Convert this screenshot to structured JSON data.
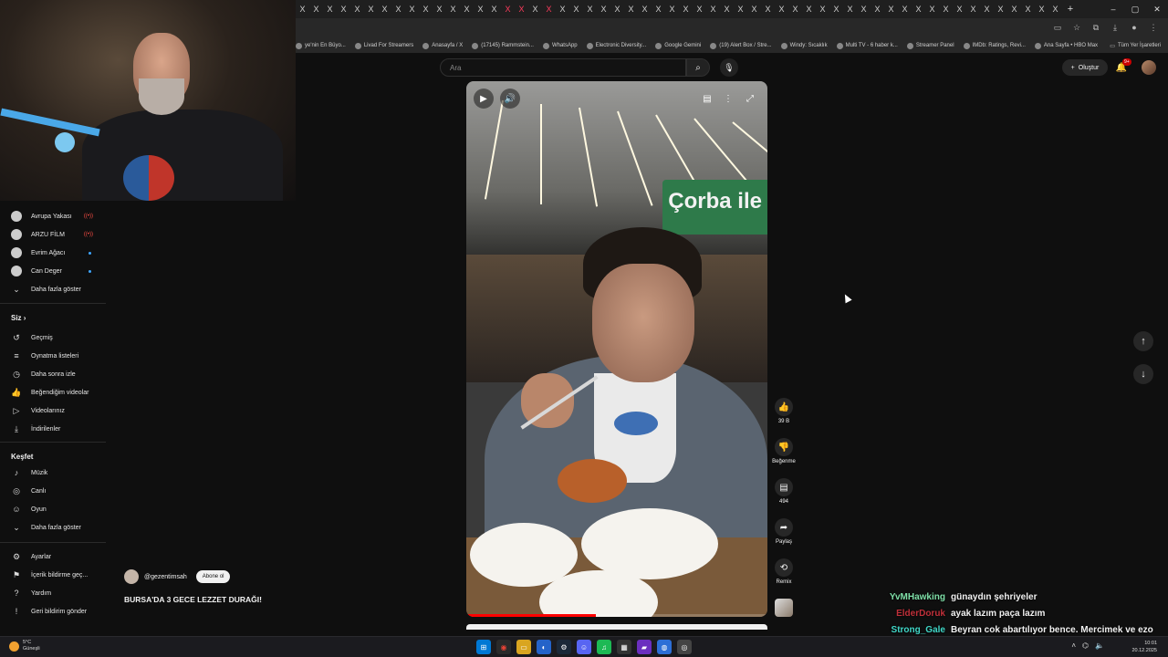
{
  "browser": {
    "tab_count": 56,
    "tab_close_glyph": "X",
    "new_tab_glyph": "+",
    "window_controls": [
      "–",
      "▢",
      "✕"
    ],
    "bookmarks": [
      {
        "label": "ye'nin En Büyo...",
        "icon": "bookmark-icon"
      },
      {
        "label": "Livad For Streamers",
        "icon": "livad-icon"
      },
      {
        "label": "Anasayfa / X",
        "icon": "x-logo-icon"
      },
      {
        "label": "(17145) Rammstein...",
        "icon": "youtube-icon"
      },
      {
        "label": "WhatsApp",
        "icon": "whatsapp-icon"
      },
      {
        "label": "Electronic Diversity...",
        "icon": "bookmark-icon"
      },
      {
        "label": "Google Gemini",
        "icon": "gemini-icon"
      },
      {
        "label": "(19) Alert Box / Stre...",
        "icon": "streamlabs-icon"
      },
      {
        "label": "Windy: Sıcaklık",
        "icon": "windy-icon"
      },
      {
        "label": "Multi TV - 6 haber k...",
        "icon": "tv-icon"
      },
      {
        "label": "Streamer Panel",
        "icon": "panel-icon"
      },
      {
        "label": "IMDb: Ratings, Revi...",
        "icon": "imdb-icon"
      },
      {
        "label": "Ana Sayfa • HBO Max",
        "icon": "hbo-icon"
      }
    ],
    "all_bookmarks_label": "Tüm Yer İşaretleri"
  },
  "youtube": {
    "search_placeholder": "Ara",
    "create_label": "Oluştur",
    "notification_count": "9+"
  },
  "sidebar": {
    "subscriptions": [
      {
        "label": "Avrupa Yakası",
        "live": true
      },
      {
        "label": "ARZU FİLM",
        "live": true
      },
      {
        "label": "Evrim Ağacı",
        "new": true
      },
      {
        "label": "Can Deger",
        "new": true
      },
      {
        "label": "Daha fazla göster"
      }
    ],
    "you_heading": "Siz",
    "you_items": [
      {
        "label": "Geçmiş",
        "icon": "history-icon"
      },
      {
        "label": "Oynatma listeleri",
        "icon": "playlists-icon"
      },
      {
        "label": "Daha sonra izle",
        "icon": "watch-later-icon"
      },
      {
        "label": "Beğendiğim videolar",
        "icon": "liked-icon"
      },
      {
        "label": "Videolarınız",
        "icon": "your-videos-icon"
      },
      {
        "label": "İndirilenler",
        "icon": "downloads-icon"
      }
    ],
    "explore_heading": "Keşfet",
    "explore_items": [
      {
        "label": "Müzik",
        "icon": "music-icon"
      },
      {
        "label": "Canlı",
        "icon": "live-icon"
      },
      {
        "label": "Oyun",
        "icon": "gaming-icon"
      },
      {
        "label": "Daha fazla göster",
        "icon": "chevron-down-icon"
      }
    ],
    "footer_items": [
      {
        "label": "Ayarlar",
        "icon": "settings-icon"
      },
      {
        "label": "İçerik bildirme geç...",
        "icon": "report-flag-icon"
      },
      {
        "label": "Yardım",
        "icon": "help-icon"
      },
      {
        "label": "Geri bildirim gönder",
        "icon": "feedback-icon"
      }
    ],
    "live_glyph": "((•))"
  },
  "short": {
    "channel": "@gezentimsah",
    "subscribe_label": "Abone ol",
    "title": "BURSA'DA 3 GECE LEZZET DURAĞI!",
    "sign_text": "Çorba ile",
    "progress": 0.43,
    "actions": {
      "likes": "39 B",
      "dislike": "Beğenme",
      "comments": "494",
      "share": "Paylaş",
      "remix": "Remix"
    }
  },
  "chat": [
    {
      "user": "YvMHawking",
      "user_color": "#7fe0a8",
      "message": "günaydın şehriyeler"
    },
    {
      "user": "ElderDoruk",
      "user_color": "#c0303a",
      "message": "ayak lazım paça lazım"
    },
    {
      "user": "Strong_Gale",
      "user_color": "#40d8c8",
      "message": "Beyran cok abartılıyor bence. Mercimek ve ezo daha iyi"
    }
  ],
  "taskbar": {
    "weather_temp": "5°C",
    "weather_desc": "Güneşli",
    "time": "10:01",
    "date": "20.12.2025"
  },
  "colors": {
    "background": "#0f0f0f",
    "accent_red": "#ff0000",
    "subscribe_bg": "#f1f1f1"
  }
}
